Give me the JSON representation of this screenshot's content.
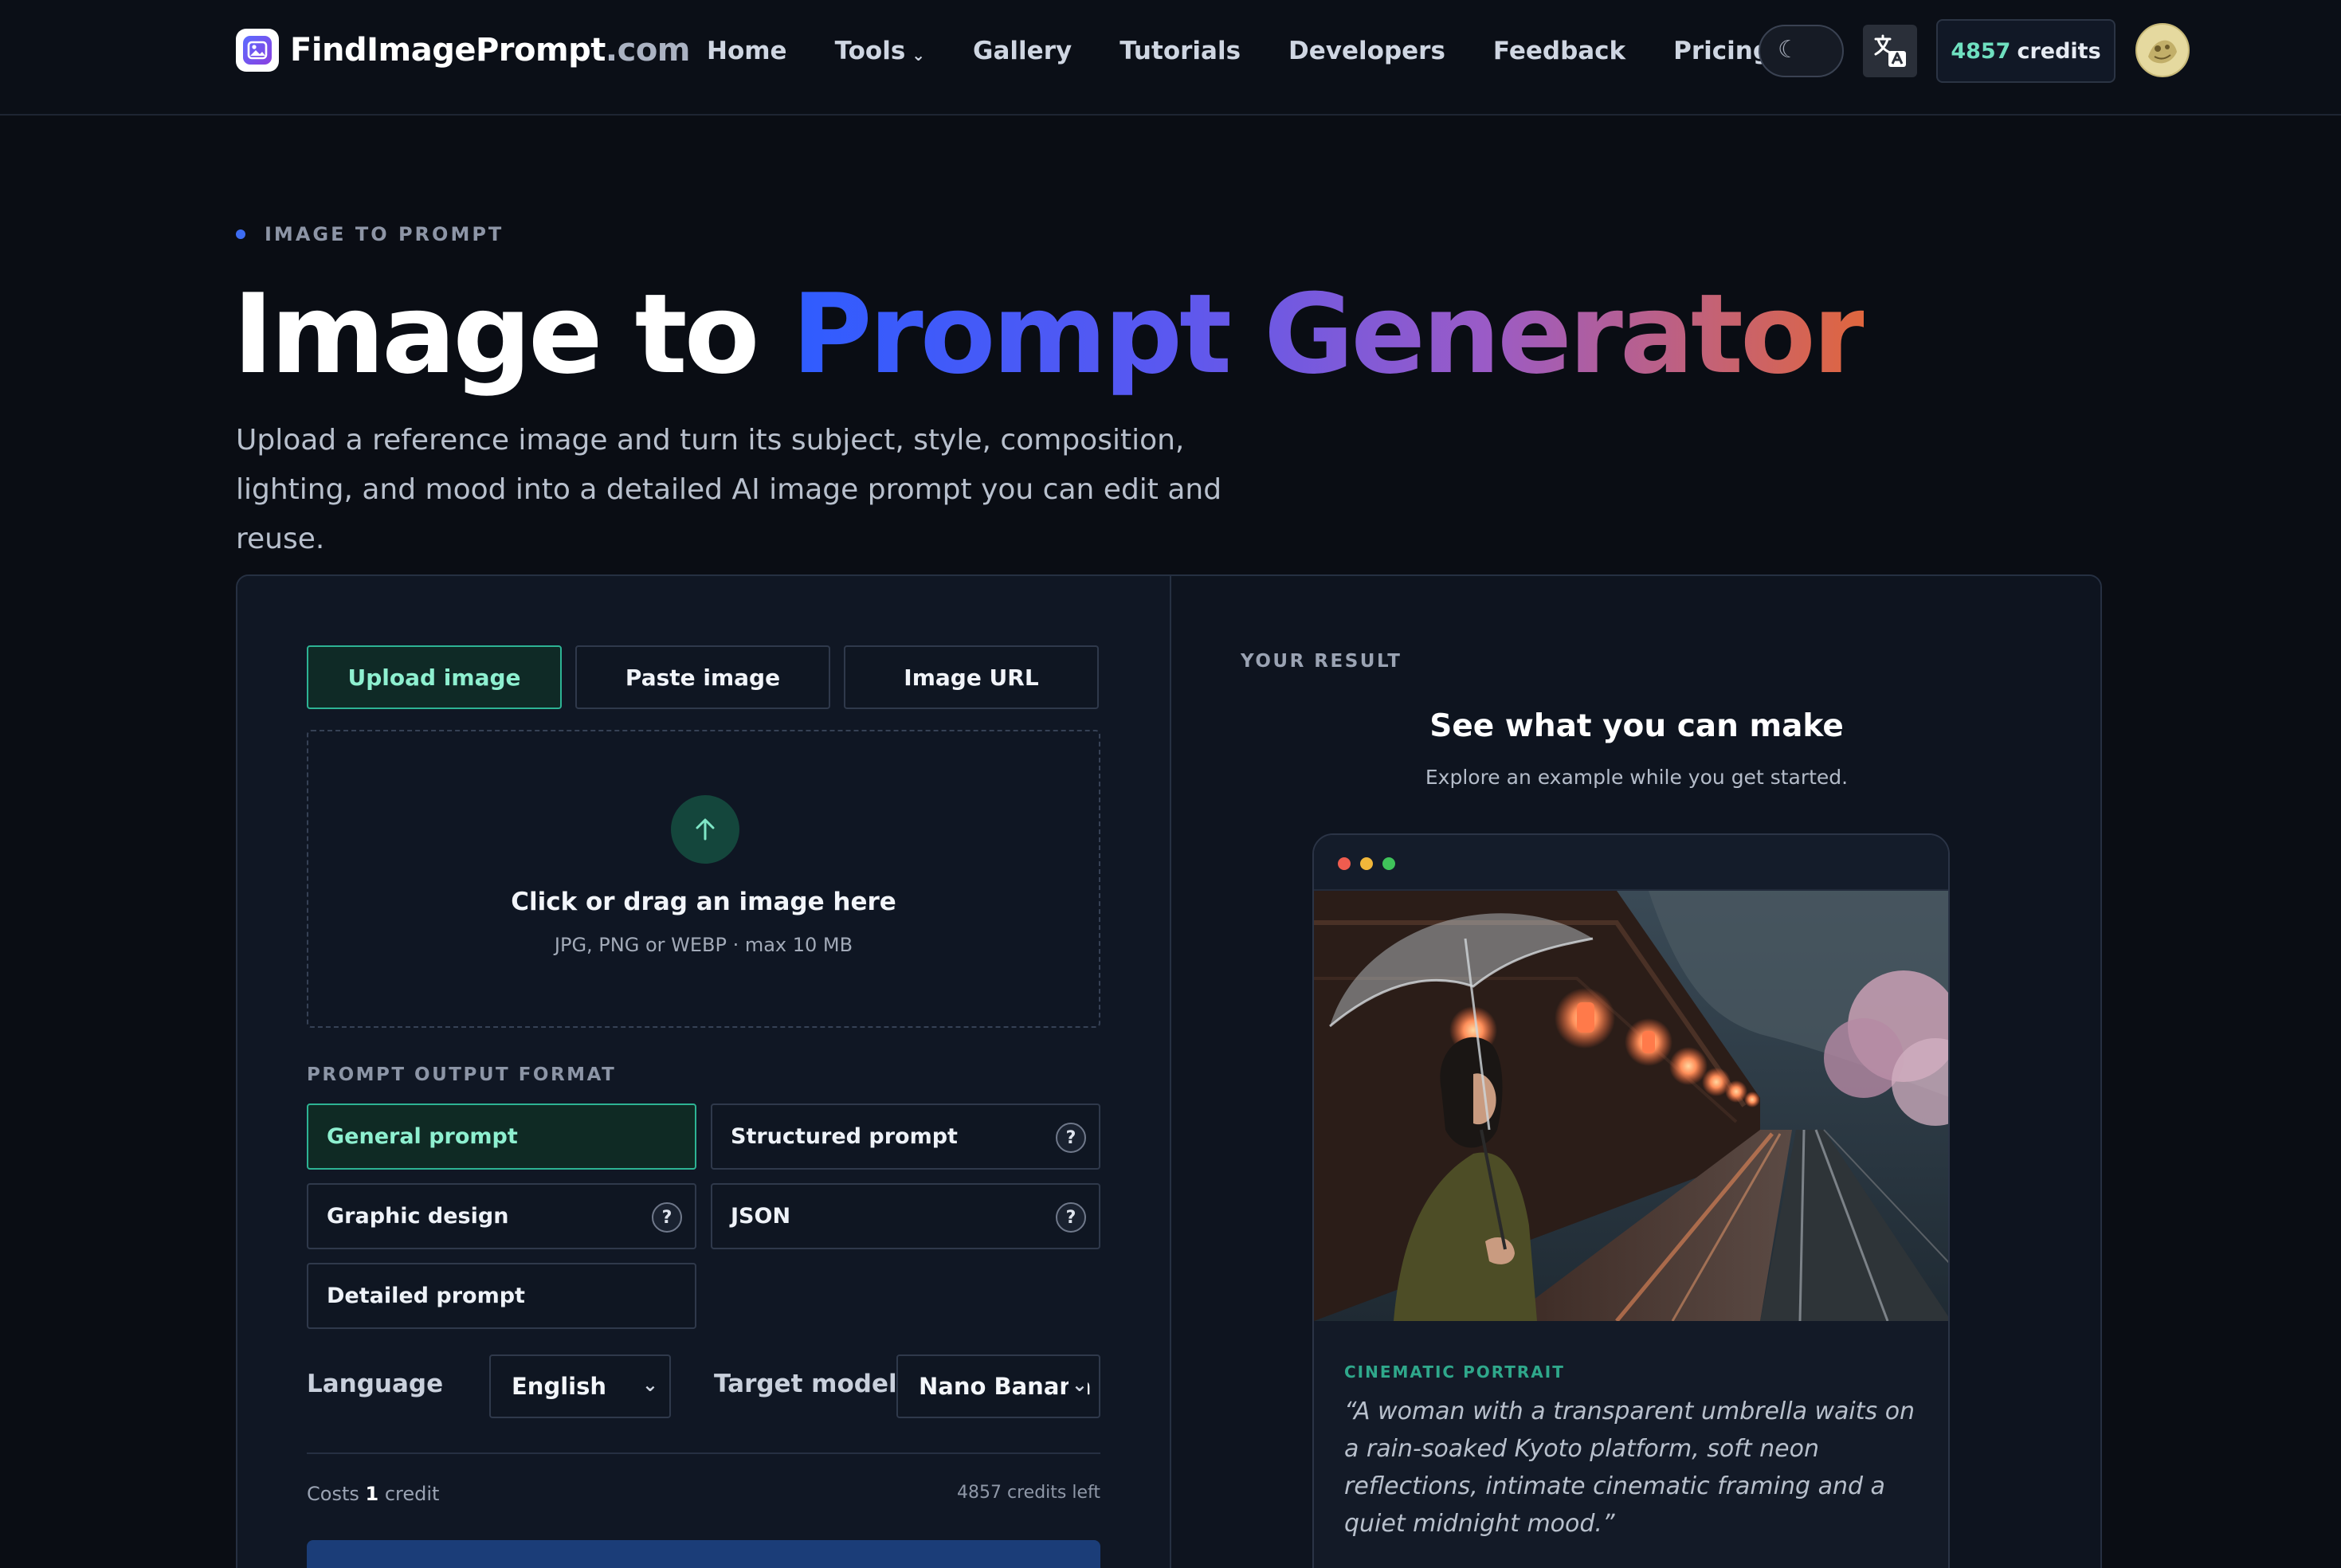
{
  "brand": {
    "name": "FindImagePrompt",
    "tld": ".com"
  },
  "nav": {
    "home": "Home",
    "tools": "Tools",
    "gallery": "Gallery",
    "tutorials": "Tutorials",
    "developers": "Developers",
    "feedback": "Feedback",
    "pricing": "Pricing"
  },
  "header": {
    "credits_count": "4857",
    "credits_label": "credits"
  },
  "hero": {
    "eyebrow": "IMAGE TO PROMPT",
    "title_plain": "Image to ",
    "title_gradient": "Prompt Generator",
    "subtitle": "Upload a reference image and turn its subject, style, composition, lighting, and mood into a detailed AI image prompt you can edit and reuse."
  },
  "input_tabs": [
    {
      "label": "Upload image",
      "active": true
    },
    {
      "label": "Paste image",
      "active": false
    },
    {
      "label": "Image URL",
      "active": false
    }
  ],
  "dropzone": {
    "title": "Click or drag an image here",
    "subtitle": "JPG, PNG or WEBP · max 10 MB"
  },
  "output_format": {
    "label": "PROMPT OUTPUT FORMAT",
    "options": [
      {
        "label": "General prompt",
        "active": true,
        "help": false
      },
      {
        "label": "Structured prompt",
        "active": false,
        "help": true
      },
      {
        "label": "Graphic design",
        "active": false,
        "help": true
      },
      {
        "label": "JSON",
        "active": false,
        "help": true
      },
      {
        "label": "Detailed prompt",
        "active": false,
        "help": false
      }
    ],
    "help_glyph": "?"
  },
  "language": {
    "label": "Language",
    "value": "English"
  },
  "target_model": {
    "label": "Target model",
    "value": "Nano Banana"
  },
  "cost": {
    "prefix": "Costs",
    "amount": "1",
    "unit": "credit",
    "remaining": "4857 credits left"
  },
  "result": {
    "label": "YOUR RESULT",
    "title": "See what you can make",
    "subtitle": "Explore an example while you get started.",
    "example": {
      "tag": "CINEMATIC PORTRAIT",
      "quote": "“A woman with a transparent umbrella waits on a rain-soaked Kyoto platform, soft neon reflections, intimate cinematic framing and a quiet midnight mood.”"
    }
  },
  "icons": {
    "logo": "image-icon",
    "theme": "moon-icon",
    "translate": "translate-icon",
    "upload": "arrow-up-icon",
    "select_caret": "chevron-down-icon"
  },
  "colors": {
    "accent_teal": "#2db394",
    "accent_blue": "#2f5cff",
    "gradient_end": "#e0663e",
    "background": "#0a0d14"
  }
}
